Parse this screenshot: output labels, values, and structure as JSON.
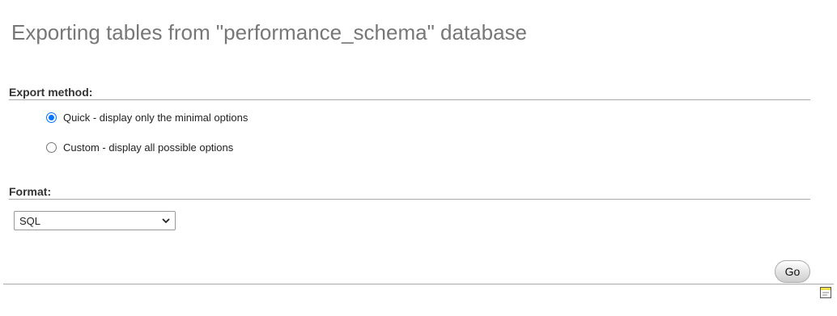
{
  "page": {
    "title": "Exporting tables from \"performance_schema\" database"
  },
  "export_method": {
    "heading": "Export method:",
    "options": [
      {
        "label": "Quick - display only the minimal options",
        "checked": true
      },
      {
        "label": "Custom - display all possible options",
        "checked": false
      }
    ]
  },
  "format": {
    "heading": "Format:",
    "selected": "SQL"
  },
  "actions": {
    "go_label": "Go"
  },
  "icons": {
    "select_arrow": "chevron-down-icon",
    "console": "console-icon"
  },
  "colors": {
    "accent": "#0075ff",
    "title": "#777777"
  }
}
